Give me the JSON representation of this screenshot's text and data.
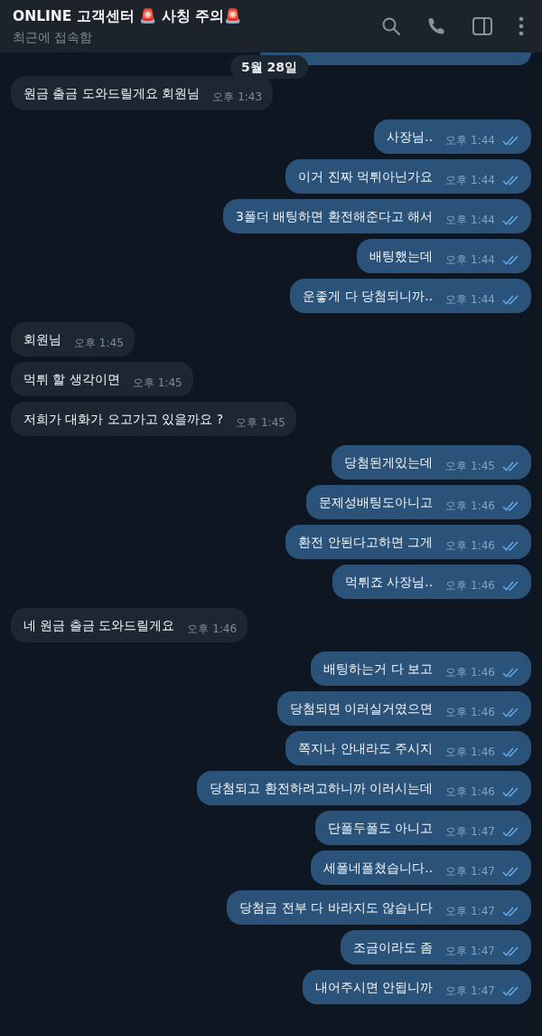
{
  "header": {
    "title": "ONLINE 고객센터 🚨 사칭 주의🚨",
    "status": "최근에 접속함"
  },
  "date_badge": "5월 28일",
  "messages": [
    {
      "kind": "partial"
    },
    {
      "kind": "in",
      "text": "원금 출금 도와드릴게요 회원님",
      "time": "오후 1:43"
    },
    {
      "kind": "out",
      "text": "사장님..",
      "time": "오후 1:44",
      "read": true
    },
    {
      "kind": "out",
      "text": "이거 진짜 먹튀아닌가요",
      "time": "오후 1:44",
      "read": true
    },
    {
      "kind": "out",
      "text": "3폴더 배팅하면 환전해준다고 해서",
      "time": "오후 1:44",
      "read": true
    },
    {
      "kind": "out",
      "text": "배팅했는데",
      "time": "오후 1:44",
      "read": true
    },
    {
      "kind": "out",
      "text": "운좋게 다 당첨되니까..",
      "time": "오후 1:44",
      "read": true
    },
    {
      "kind": "in",
      "text": "회원님",
      "time": "오후 1:45"
    },
    {
      "kind": "in",
      "text": "먹튀 할 생각이면",
      "time": "오후 1:45"
    },
    {
      "kind": "in",
      "text": "저희가 대화가 오고가고 있을까요 ?",
      "time": "오후 1:45"
    },
    {
      "kind": "out",
      "text": "당첨된게있는데",
      "time": "오후 1:45",
      "read": true
    },
    {
      "kind": "out",
      "text": "문제성배팅도아니고",
      "time": "오후 1:46",
      "read": true
    },
    {
      "kind": "out",
      "text": "환전 안된다고하면 그게",
      "time": "오후 1:46",
      "read": true
    },
    {
      "kind": "out",
      "text": "먹튀죠 사장님..",
      "time": "오후 1:46",
      "read": true
    },
    {
      "kind": "in",
      "text": "네 원금 출금 도와드릴게요",
      "time": "오후 1:46"
    },
    {
      "kind": "out",
      "text": "배팅하는거 다 보고",
      "time": "오후 1:46",
      "read": true
    },
    {
      "kind": "out",
      "text": "당첨되면 이러실거였으면",
      "time": "오후 1:46",
      "read": true
    },
    {
      "kind": "out",
      "text": "쪽지나 안내라도 주시지",
      "time": "오후 1:46",
      "read": true
    },
    {
      "kind": "out",
      "text": "당첨되고 환전하려고하니까 이러시는데",
      "time": "오후 1:46",
      "read": true
    },
    {
      "kind": "out",
      "text": "단폴두폴도 아니고",
      "time": "오후 1:47",
      "read": true
    },
    {
      "kind": "out",
      "text": "세폴네폴쳤습니다..",
      "time": "오후 1:47",
      "read": true
    },
    {
      "kind": "out",
      "text": "당첨금 전부 다 바라지도 않습니다",
      "time": "오후 1:47",
      "read": true
    },
    {
      "kind": "out",
      "text": "조금이라도 좀",
      "time": "오후 1:47",
      "read": true
    },
    {
      "kind": "out",
      "text": "내어주시면 안됩니까",
      "time": "오후 1:47",
      "read": true
    }
  ]
}
